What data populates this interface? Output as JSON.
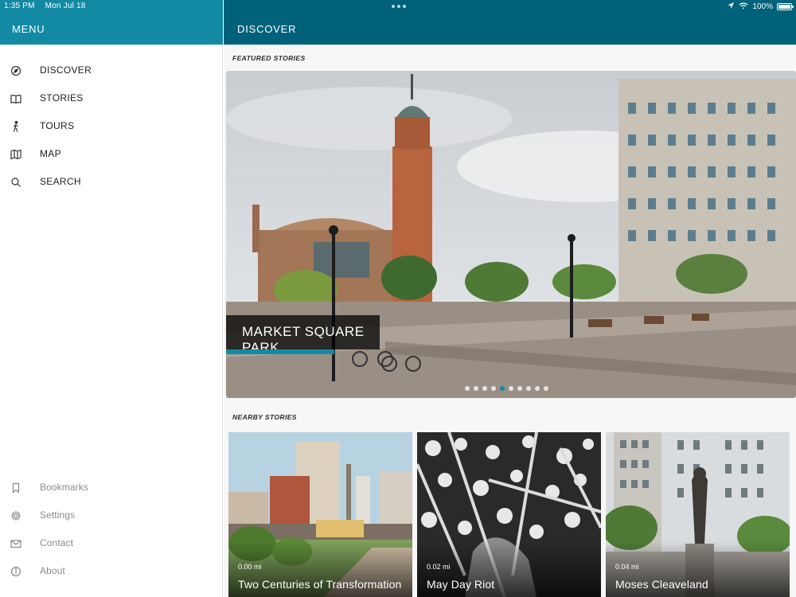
{
  "status_bar": {
    "time": "1:35 PM",
    "date": "Mon Jul 18",
    "battery": "100%",
    "icons": [
      "location-arrow-icon",
      "wifi-icon",
      "battery-icon"
    ]
  },
  "sidebar": {
    "title": "MENU",
    "items": [
      {
        "label": "DISCOVER",
        "icon": "compass-icon"
      },
      {
        "label": "STORIES",
        "icon": "book-icon"
      },
      {
        "label": "TOURS",
        "icon": "walking-icon"
      },
      {
        "label": "MAP",
        "icon": "map-icon"
      },
      {
        "label": "SEARCH",
        "icon": "search-icon"
      }
    ],
    "bottom_items": [
      {
        "label": "Bookmarks",
        "icon": "bookmark-icon"
      },
      {
        "label": "Settings",
        "icon": "gear-icon"
      },
      {
        "label": "Contact",
        "icon": "mail-icon"
      },
      {
        "label": "About",
        "icon": "info-icon"
      }
    ]
  },
  "main": {
    "title": "DISCOVER",
    "featured_label": "FEATURED STORIES",
    "featured": {
      "title": "MARKET SQUARE PARK",
      "pager_count": 10,
      "pager_active_index": 4
    },
    "nearby_label": "NEARBY STORIES",
    "nearby": [
      {
        "distance": "0.00 mi",
        "title": "Two Centuries of Transformation"
      },
      {
        "distance": "0.02 mi",
        "title": "May Day Riot"
      },
      {
        "distance": "0.04 mi",
        "title": "Moses Cleaveland"
      }
    ]
  },
  "colors": {
    "sidebar_header": "#128aa4",
    "main_header": "#00627a",
    "accent": "#128aa4"
  }
}
